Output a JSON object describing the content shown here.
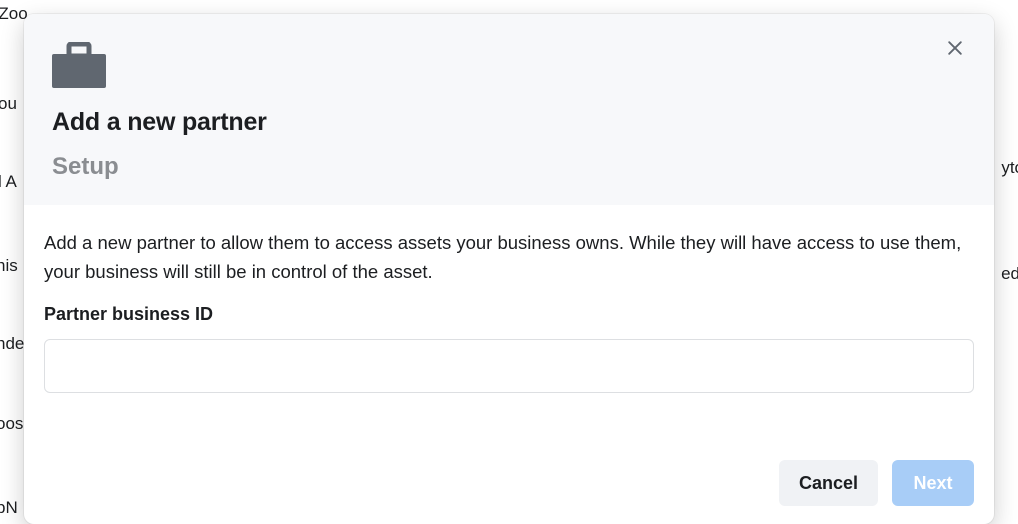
{
  "modal": {
    "title": "Add a new partner",
    "subtitle": "Setup",
    "description": "Add a new partner to allow them to access assets your business owns. While they will have access to use them, your business will still be in control of the asset.",
    "field_label": "Partner business ID",
    "input_value": "",
    "input_placeholder": ""
  },
  "buttons": {
    "cancel": "Cancel",
    "next": "Next"
  },
  "colors": {
    "header_bg": "#f7f8fa",
    "primary_disabled": "#a8cdf7",
    "text": "#1c1e21",
    "muted": "#8a8d91",
    "border": "#dddfe2"
  },
  "background_fragments": {
    "f1": "r Zoo",
    "f2": "ou",
    "f3": "l A",
    "f4": "nis",
    "f5": "nde",
    "f6": "oos",
    "f7": "pN",
    "f8": "yto",
    "f9": "ed"
  }
}
